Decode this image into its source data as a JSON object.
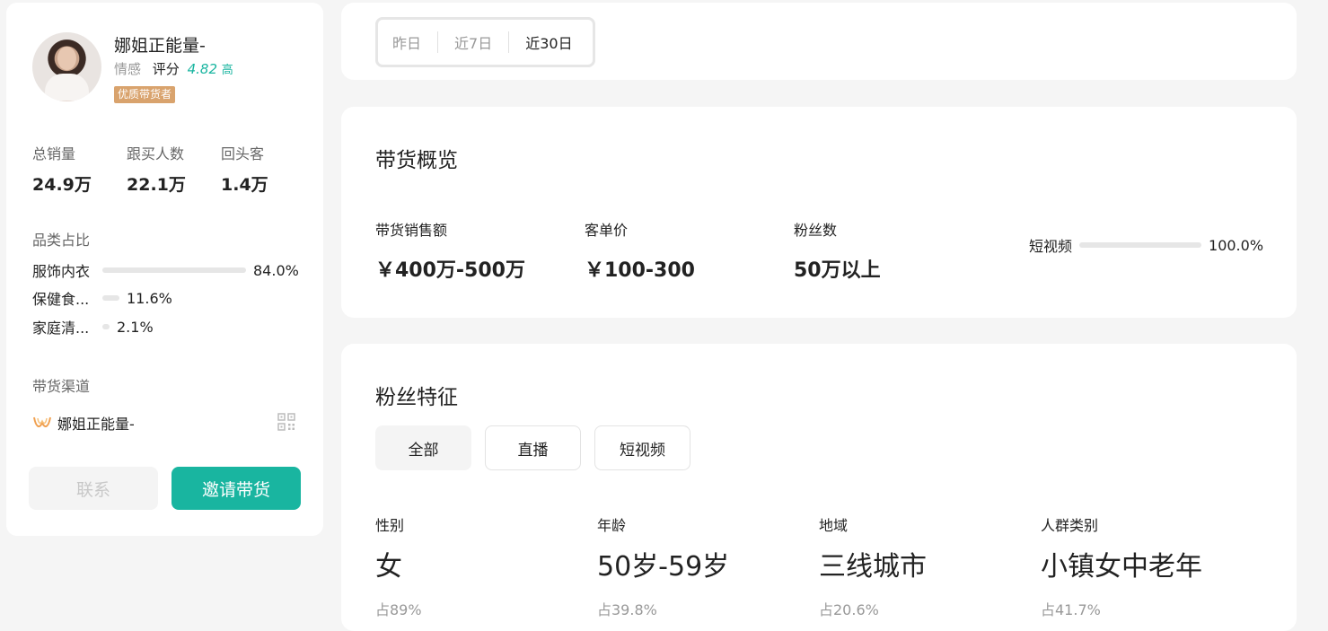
{
  "profile": {
    "name": "娜姐正能量-",
    "category": "情感",
    "score_label": "评分",
    "score": "4.82",
    "score_level": "高",
    "badge": "优质带货者"
  },
  "stats": [
    {
      "label": "总销量",
      "value": "24.9万"
    },
    {
      "label": "跟买人数",
      "value": "22.1万"
    },
    {
      "label": "回头客",
      "value": "1.4万"
    }
  ],
  "category_share": {
    "title": "品类占比",
    "items": [
      {
        "label": "服饰内衣",
        "percent": 84.0,
        "display": "84.0%"
      },
      {
        "label": "保健食...",
        "percent": 11.6,
        "display": "11.6%"
      },
      {
        "label": "家庭清...",
        "percent": 2.1,
        "display": "2.1%"
      }
    ]
  },
  "channel": {
    "title": "带货渠道",
    "name": "娜姐正能量-",
    "icon": "douyin-logo-icon"
  },
  "actions": {
    "contact_label": "联系",
    "invite_label": "邀请带货"
  },
  "date_tabs": {
    "items": [
      "昨日",
      "近7日",
      "近30日"
    ],
    "selected": "近30日"
  },
  "overview": {
    "title": "带货概览",
    "metrics": [
      {
        "label": "带货销售额",
        "value": "￥400万-500万"
      },
      {
        "label": "客单价",
        "value": "￥100-300"
      },
      {
        "label": "粉丝数",
        "value": "50万以上"
      }
    ],
    "short_video": {
      "label": "短视频",
      "percent": 100.0,
      "display": "100.0%"
    }
  },
  "fans": {
    "title": "粉丝特征",
    "tabs": [
      "全部",
      "直播",
      "短视频"
    ],
    "selected_tab": "全部",
    "features": [
      {
        "label": "性别",
        "value": "女",
        "share": "占89%"
      },
      {
        "label": "年龄",
        "value": "50岁-59岁",
        "share": "占39.8%"
      },
      {
        "label": "地域",
        "value": "三线城市",
        "share": "占20.6%"
      },
      {
        "label": "人群类别",
        "value": "小镇女中老年",
        "share": "占41.7%"
      }
    ]
  },
  "colors": {
    "accent": "#19b5a0",
    "badge": "#d9a36d",
    "muted": "#999999"
  }
}
